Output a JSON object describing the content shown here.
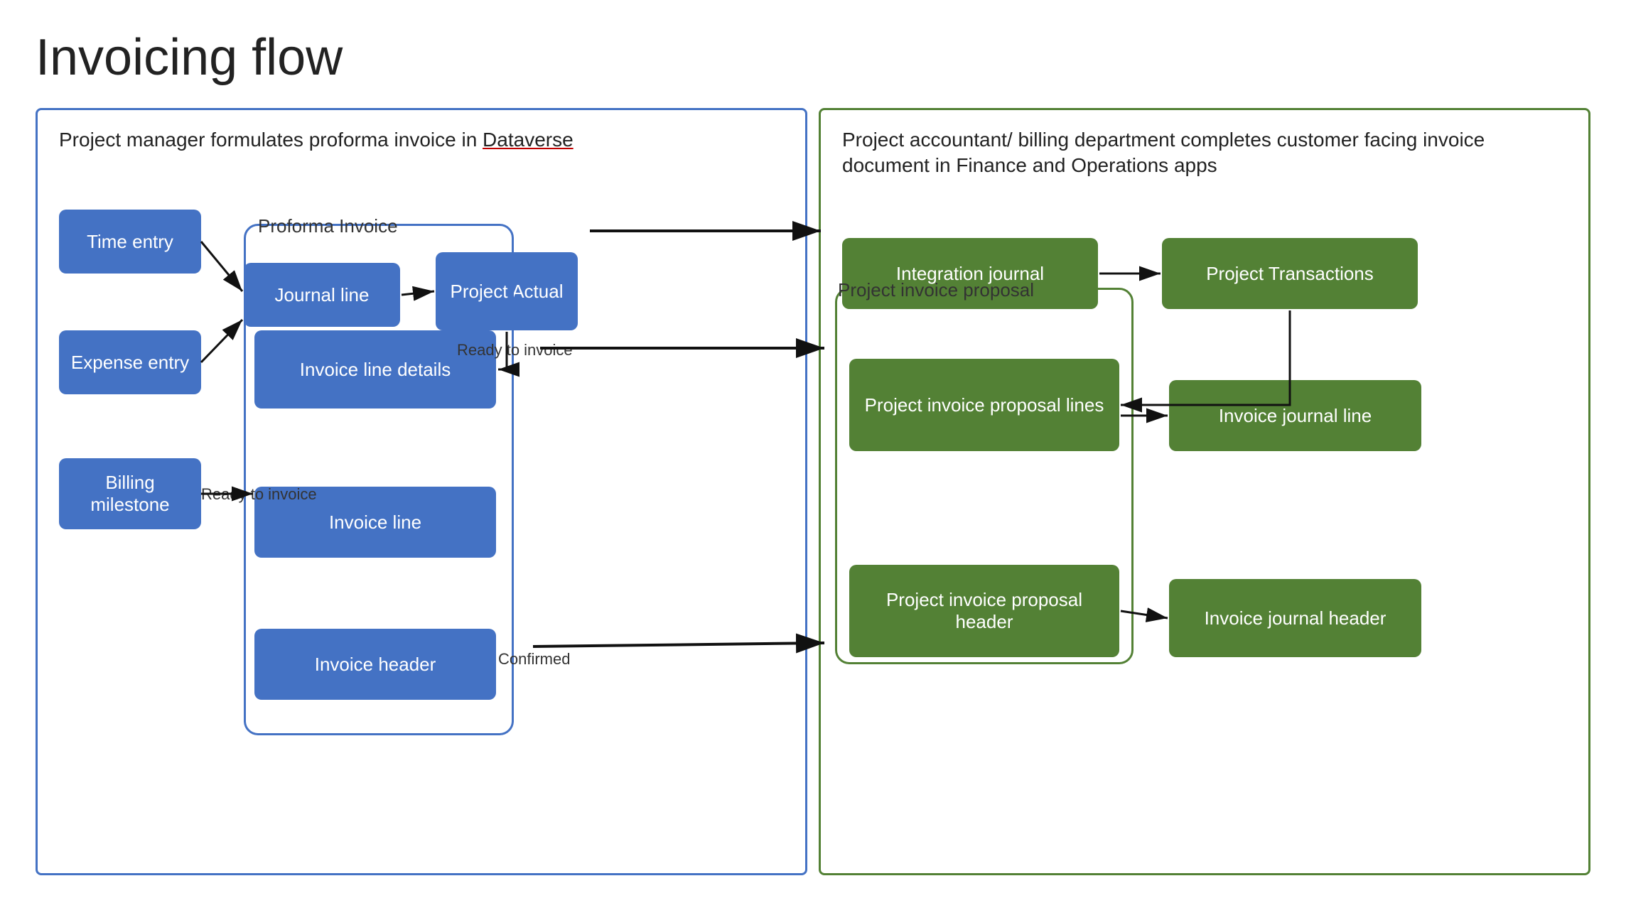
{
  "title": "Invoicing flow",
  "left_panel": {
    "description": "Project manager formulates proforma invoice in ",
    "dataverse": "Dataverse",
    "boxes": {
      "time_entry": "Time entry",
      "expense_entry": "Expense entry",
      "billing_milestone": "Billing milestone",
      "journal_line": "Journal line",
      "project_actual": "Project Actual",
      "invoice_line_details": "Invoice line details",
      "invoice_line": "Invoice line",
      "invoice_header": "Invoice header"
    },
    "proforma_label": "Proforma Invoice",
    "labels": {
      "ready_to_invoice_1": "Ready to invoice",
      "ready_to_invoice_2": "Ready to\ninvoice",
      "confirmed": "Confirmed"
    }
  },
  "right_panel": {
    "description": "Project accountant/ billing department completes customer facing invoice document in Finance and Operations apps",
    "boxes": {
      "integration_journal": "Integration journal",
      "project_transactions": "Project Transactions",
      "project_invoice_proposal_lines": "Project invoice proposal lines",
      "invoice_journal_line": "Invoice journal line",
      "project_invoice_proposal_header": "Project invoice proposal header",
      "invoice_journal_header": "Invoice journal header"
    },
    "proposal_label": "Project invoice proposal"
  }
}
